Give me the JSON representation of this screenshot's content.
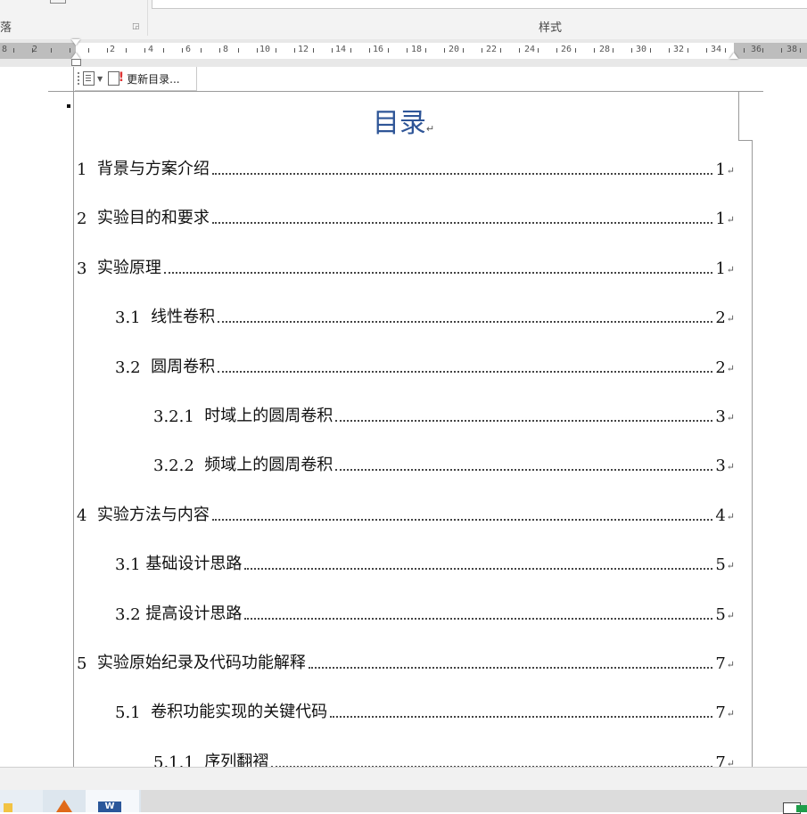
{
  "ribbon": {
    "paragraph_group_label": "落",
    "styles_group_label": "样式"
  },
  "ruler": {
    "labels": [
      "8",
      "2",
      "2",
      "4",
      "6",
      "8",
      "10",
      "12",
      "14",
      "16",
      "18",
      "20",
      "22",
      "24",
      "26",
      "28",
      "30",
      "32",
      "34",
      "36",
      "38"
    ]
  },
  "toc_toolbar": {
    "update_label": "更新目录..."
  },
  "document": {
    "title": "目录",
    "paragraph_mark": "↵",
    "entries": [
      {
        "num": "1  ",
        "text": "背景与方案介绍",
        "page": "1"
      },
      {
        "num": "2  ",
        "text": "实验目的和要求",
        "page": "1"
      },
      {
        "num": "3  ",
        "text": "实验原理",
        "page": "1"
      },
      {
        "num": "3.1  ",
        "text": "线性卷积",
        "page": "2"
      },
      {
        "num": "3.2  ",
        "text": "圆周卷积",
        "page": "2"
      },
      {
        "num": "3.2.1  ",
        "text": "时域上的圆周卷积",
        "page": "3"
      },
      {
        "num": "3.2.2  ",
        "text": "频域上的圆周卷积",
        "page": "3"
      },
      {
        "num": "4  ",
        "text": "实验方法与内容",
        "page": "4"
      },
      {
        "num": "3.1 ",
        "text": "基础设计思路",
        "page": "5"
      },
      {
        "num": "3.2 ",
        "text": "提高设计思路",
        "page": "5"
      },
      {
        "num": "5  ",
        "text": "实验原始纪录及代码功能解释",
        "page": "7"
      },
      {
        "num": "5.1  ",
        "text": "卷积功能实现的关键代码",
        "page": "7"
      },
      {
        "num": "5.1.1  ",
        "text": "序列翻褶",
        "page": "7"
      }
    ]
  },
  "taskbar": {
    "word_icon_label": "W"
  },
  "colors": {
    "title_blue": "#2e5597",
    "word_blue": "#2b579a"
  }
}
